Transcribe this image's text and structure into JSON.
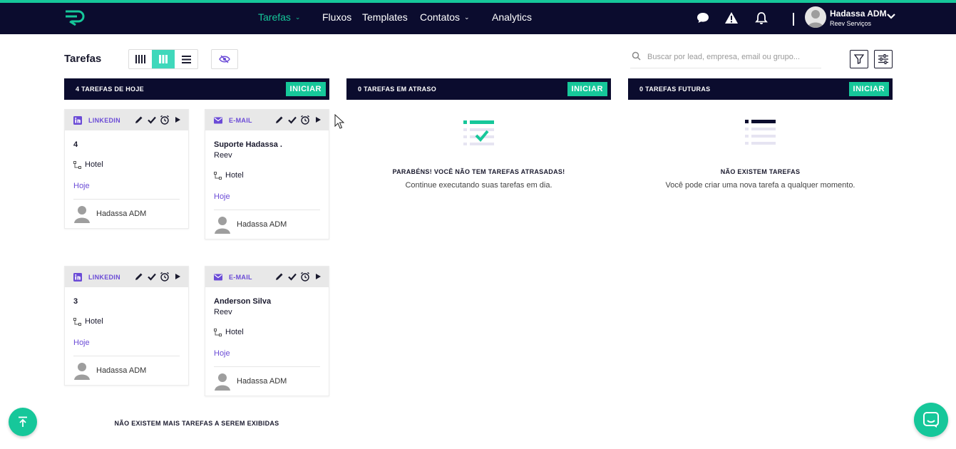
{
  "nav": {
    "items": [
      {
        "label": "Tarefas",
        "active": true,
        "has_dropdown": true
      },
      {
        "label": "Fluxos",
        "active": false,
        "has_dropdown": false
      },
      {
        "label": "Templates",
        "active": false,
        "has_dropdown": false
      },
      {
        "label": "Contatos",
        "active": false,
        "has_dropdown": true
      },
      {
        "label": "Analytics",
        "active": false,
        "has_dropdown": false
      }
    ],
    "icons": [
      "chat-icon",
      "alert-icon",
      "bell-icon"
    ]
  },
  "user": {
    "name": "Hadassa ADM",
    "company": "Reev Serviços"
  },
  "page": {
    "title": "Tarefas",
    "search_placeholder": "Buscar por lead, empresa, email ou grupo..."
  },
  "columns": [
    {
      "count_label": "4  TAREFAS DE HOJE",
      "start_label": "INICIAR"
    },
    {
      "count_label": "0  TAREFAS EM ATRASO",
      "start_label": "INICIAR"
    },
    {
      "count_label": "0  TAREFAS FUTURAS",
      "start_label": "INICIAR"
    }
  ],
  "cards": [
    {
      "type": "LINKEDIN",
      "title": "4",
      "subtitle": "",
      "tag": "Hotel",
      "date": "Hoje",
      "owner": "Hadassa ADM"
    },
    {
      "type": "E-MAIL",
      "title": "Suporte Hadassa .",
      "subtitle": "Reev",
      "tag": "Hotel",
      "date": "Hoje",
      "owner": "Hadassa ADM"
    },
    {
      "type": "LINKEDIN",
      "title": "3",
      "subtitle": "",
      "tag": "Hotel",
      "date": "Hoje",
      "owner": "Hadassa ADM"
    },
    {
      "type": "E-MAIL",
      "title": "Anderson Silva",
      "subtitle": "Reev",
      "tag": "Hotel",
      "date": "Hoje",
      "owner": "Hadassa ADM"
    }
  ],
  "end_note": "NÃO EXISTEM MAIS TAREFAS A SEREM EXIBIDAS",
  "overdue_empty": {
    "title": "PARABÉNS! VOCÊ NÃO TEM TAREFAS ATRASADAS!",
    "text": "Continue executando suas tarefas em dia."
  },
  "future_empty": {
    "title": "NÃO EXISTEM TAREFAS",
    "text": "Você pode criar uma nova tarefa a qualquer momento."
  },
  "colors": {
    "navy": "#0b0c2e",
    "accent": "#16c79a",
    "purple": "#6b4bd6"
  }
}
